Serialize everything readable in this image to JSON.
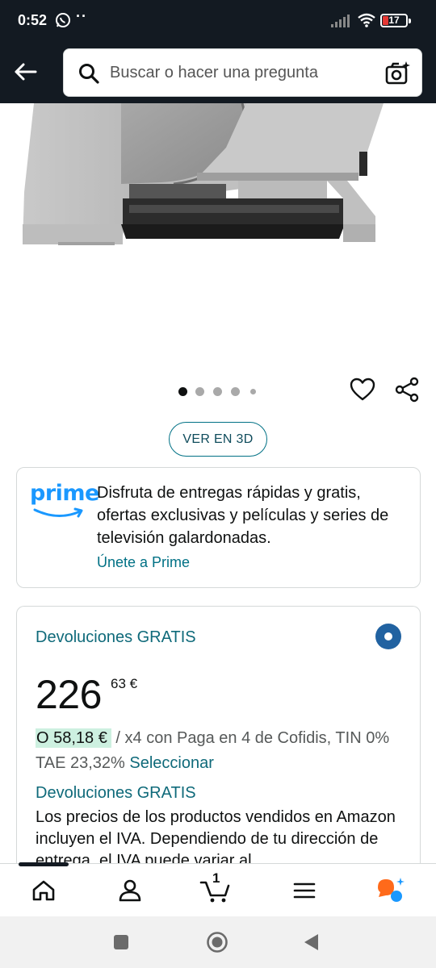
{
  "status_bar": {
    "time": "0:52",
    "battery": "17",
    "extra": "··"
  },
  "header": {
    "search_placeholder": "Buscar o hacer una pregunta"
  },
  "gallery": {
    "image_count": 5,
    "active_index": 0,
    "view_3d_label": "VER EN 3D"
  },
  "prime": {
    "logo_text": "prime",
    "description": "Disfruta de entregas rápidas y gratis, ofertas exclusivas y películas y series de televisión galardonadas.",
    "join_link": "Únete a Prime"
  },
  "buy_box": {
    "returns_label": "Devoluciones GRATIS",
    "price_whole": "226",
    "price_fraction": "63 €",
    "installment_amount": "O 58,18 €",
    "installment_text": " / x4 con Paga en 4 de Cofidis, TIN 0% TAE 23,32% ",
    "installment_link": "Seleccionar",
    "returns_label_2": "Devoluciones GRATIS",
    "vat_text": "Los precios de los productos vendidos en Amazon incluyen el IVA. Dependiendo de tu dirección de entrega, el IVA puede variar al"
  },
  "bottom_nav": {
    "cart_count": "1"
  },
  "colors": {
    "header_bg": "#131a22",
    "link": "#007185",
    "prime_blue": "#1a98ff",
    "radio_blue": "#2162a1",
    "installment_highlight": "#cdf0e0"
  }
}
